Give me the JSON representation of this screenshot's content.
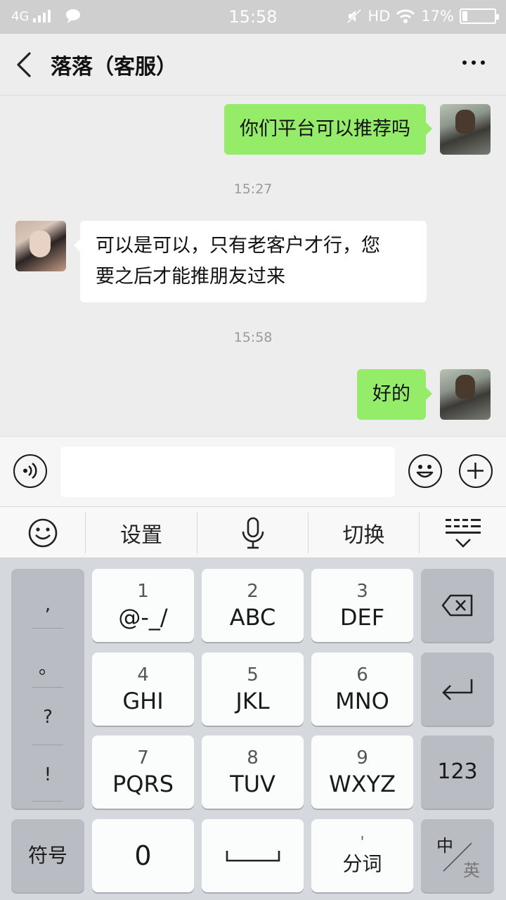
{
  "status_bar": {
    "network": "4G",
    "time": "15:58",
    "hd": "HD",
    "battery": "17%"
  },
  "header": {
    "title": "落落（客服）"
  },
  "messages": [
    {
      "from": "me",
      "text": "你们平台可以推荐吗"
    },
    {
      "type": "timestamp",
      "text": "15:27"
    },
    {
      "from": "other",
      "line1": "可以是可以，只有老客户才行，您",
      "line2": "要之后才能推朋友过来"
    },
    {
      "type": "timestamp",
      "text": "15:58"
    },
    {
      "from": "me",
      "text": "好的"
    }
  ],
  "input_bar": {
    "value": "",
    "icons": [
      "voice-icon",
      "emoji-icon",
      "plus-icon"
    ]
  },
  "ime_toolbar": {
    "settings": "设置",
    "switch": "切换",
    "icons": [
      "smiley-icon",
      "microphone-icon",
      "keyboard-collapse-icon"
    ]
  },
  "keyboard": {
    "punct": [
      ",",
      "。",
      "?",
      "!"
    ],
    "keys": [
      {
        "num": "1",
        "letters": "@-_/"
      },
      {
        "num": "2",
        "letters": "ABC"
      },
      {
        "num": "3",
        "letters": "DEF"
      },
      {
        "num": "4",
        "letters": "GHI"
      },
      {
        "num": "5",
        "letters": "JKL"
      },
      {
        "num": "6",
        "letters": "MNO"
      },
      {
        "num": "7",
        "letters": "PQRS"
      },
      {
        "num": "8",
        "letters": "TUV"
      },
      {
        "num": "9",
        "letters": "WXYZ"
      }
    ],
    "numeric_toggle": "123",
    "symbols": "符号",
    "zero": "0",
    "fenci_mark": "'",
    "fenci": "分词",
    "lang_zh": "中",
    "lang_en": "英"
  }
}
